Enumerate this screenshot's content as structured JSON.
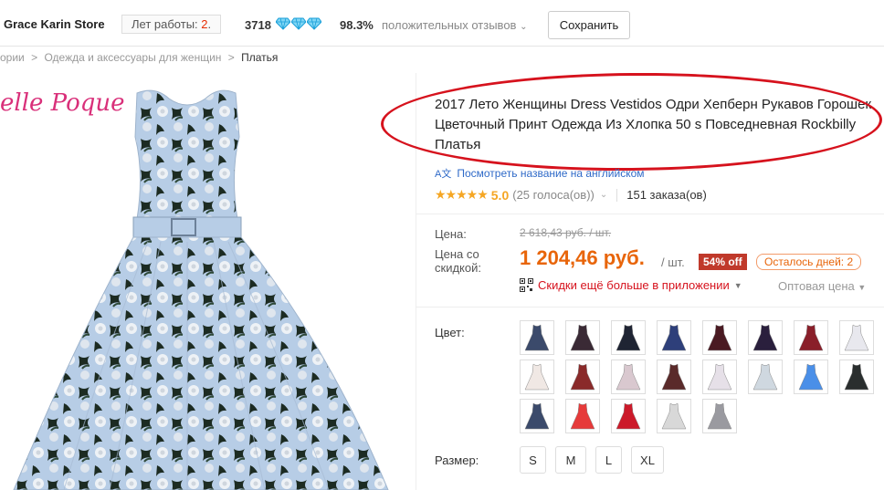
{
  "header": {
    "store_name": "Grace Karin Store",
    "years_label": "Лет работы:",
    "years_value": "2",
    "years_suffix": ".",
    "rating_count": "3718",
    "positive_pct": "98.3%",
    "positive_label": "положительных отзывов",
    "save_label": "Сохранить"
  },
  "breadcrumb": {
    "prev": "ории",
    "sep1": ">",
    "category": "Одежда и аксессуары для женщин",
    "sep2": ">",
    "current": "Платья"
  },
  "gallery": {
    "brand_text": "elle Poque"
  },
  "product": {
    "title": "2017 Лето Женщины Dress Vestidos Одри Хепберн Рукавов Горошек Цветочный Принт Одежда Из Хлопка 50 s Повседневная Rockbilly Платья",
    "translate_link": "Посмотреть название на английском",
    "translate_icon": "A文",
    "stars": "★★★★★",
    "rating": "5.0",
    "votes": "(25 голоса(ов))",
    "orders": "151 заказа(ов)"
  },
  "price": {
    "price_label": "Цена:",
    "old_price": "2 618,43 руб. / шт.",
    "discount_label_1": "Цена со",
    "discount_label_2": "скидкой:",
    "new_price": "1 204,46 руб.",
    "per_unit": "/ шт.",
    "off_badge": "54% off",
    "days_left": "Осталось дней: 2",
    "app_deal": "Скидки ещё больше в приложении",
    "wholesale": "Оптовая цена"
  },
  "options": {
    "color_label": "Цвет:",
    "size_label": "Размер:",
    "sizes": [
      "S",
      "M",
      "L",
      "XL"
    ],
    "colors": [
      "#3b4a6b",
      "#3a2a35",
      "#1f2433",
      "#2e3f7a",
      "#4a1a22",
      "#2a1f3d",
      "#8a1f2a",
      "#e8e8ee",
      "#f0e8e4",
      "#8a2a2a",
      "#d9c8cf",
      "#5a2a2a",
      "#e6e0e8",
      "#cfd8e0",
      "#4a8fe8",
      "#2a2e2e",
      "#3b4a6b",
      "#e63a3a",
      "#cc1a2a",
      "#d8d8d8",
      "#9a9aa0"
    ]
  },
  "colors": {
    "price": "#e8650a",
    "accent_red": "#d6121d",
    "link": "#2f6ac8",
    "star": "#f5a623"
  }
}
